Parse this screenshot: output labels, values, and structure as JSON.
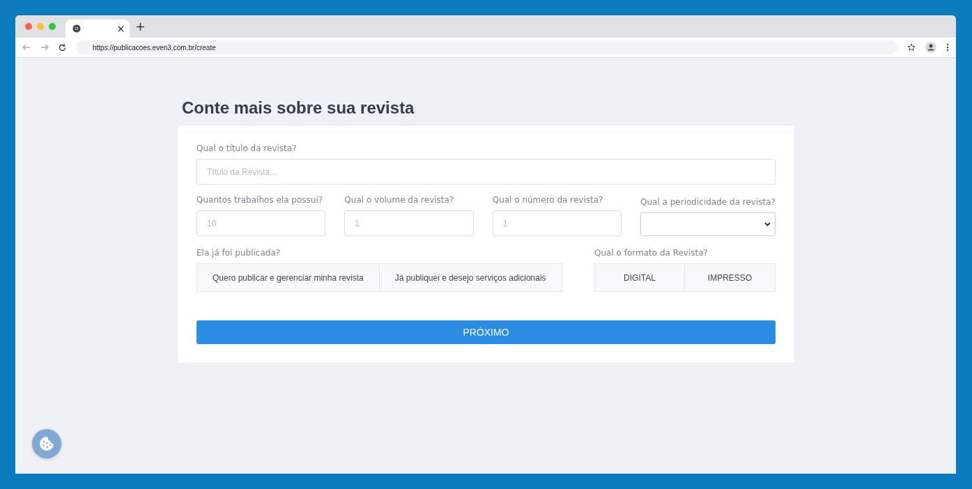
{
  "browser": {
    "url": "https://publicacoes.even3.com.br/create"
  },
  "page": {
    "heading": "Conte mais sobre sua revista"
  },
  "form": {
    "title_field": {
      "label": "Qual o título da revista?",
      "placeholder": "Título da Revista..."
    },
    "row_fields": [
      {
        "kind": "input",
        "label": "Quantos trabalhos ela possui?",
        "placeholder": "10"
      },
      {
        "kind": "input",
        "label": "Qual o volume da revista?",
        "placeholder": "1"
      },
      {
        "kind": "input",
        "label": "Qual o número da revista?",
        "placeholder": "1"
      },
      {
        "kind": "select",
        "label": "Qual a periodicidade da revista?"
      }
    ],
    "published": {
      "label": "Ela já foi publicada?",
      "options": [
        {
          "label": "Quero publicar e gerenciar minha revista",
          "selected": false
        },
        {
          "label": "Já publiquei e desejo serviços adicionais",
          "selected": false
        }
      ]
    },
    "format": {
      "label": "Qual o formato da Revista?",
      "options": [
        {
          "label": "DIGITAL",
          "selected": false
        },
        {
          "label": "IMPRESSO",
          "selected": false
        }
      ]
    },
    "submit": "PRÓXIMO"
  }
}
